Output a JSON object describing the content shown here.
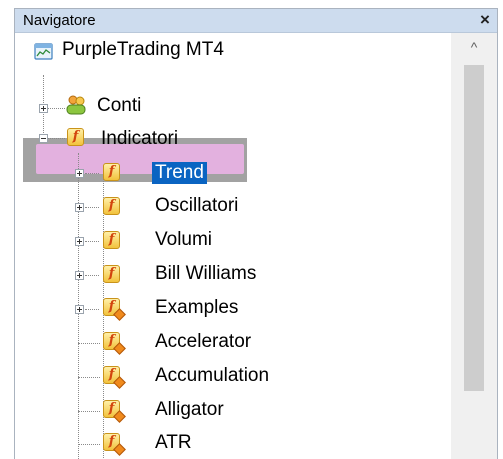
{
  "window": {
    "title": "Navigatore",
    "close_glyph": "×"
  },
  "tree": {
    "root": {
      "label": "PurpleTrading MT4",
      "icon": "account-window-icon"
    },
    "conti": {
      "label": "Conti",
      "icon": "accounts-people-icon"
    },
    "indicatori": {
      "label": "Indicatori",
      "icon": "indicator-folder-icon"
    },
    "children": [
      {
        "label": "Trend",
        "icon": "indicator-folder-icon",
        "expandable": true,
        "selected": true
      },
      {
        "label": "Oscillatori",
        "icon": "indicator-folder-icon",
        "expandable": true
      },
      {
        "label": "Volumi",
        "icon": "indicator-folder-icon",
        "expandable": true
      },
      {
        "label": "Bill Williams",
        "icon": "indicator-folder-icon",
        "expandable": true
      },
      {
        "label": "Examples",
        "icon": "custom-indicator-icon",
        "expandable": true
      },
      {
        "label": "Accelerator",
        "icon": "custom-indicator-icon"
      },
      {
        "label": "Accumulation",
        "icon": "custom-indicator-icon"
      },
      {
        "label": "Alligator",
        "icon": "custom-indicator-icon"
      },
      {
        "label": "ATR",
        "icon": "custom-indicator-icon"
      }
    ]
  },
  "scrollbar": {
    "up_glyph": "^"
  },
  "colors": {
    "selection": "#0a64c2",
    "highlight_pill": "#e3b1df",
    "highlight_band": "#8e8e8e",
    "titlebar": "#cddcee"
  }
}
